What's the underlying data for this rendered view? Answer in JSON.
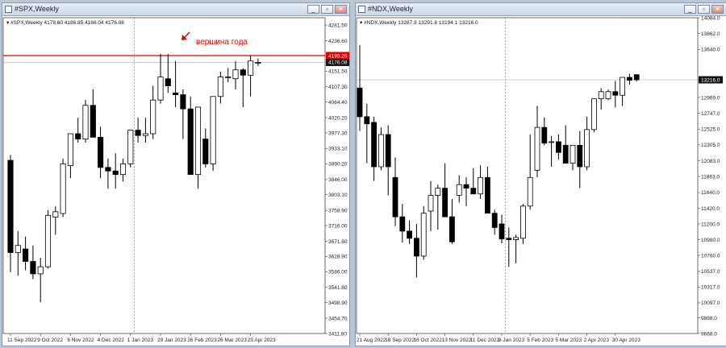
{
  "colors": {
    "bull_body": "#ffffff",
    "bear_body": "#000000",
    "candle_outline": "#000000",
    "level_line": "#e00000",
    "annotation": "#e00000",
    "current_price_label": "#111111",
    "grid": "#9a9a9a"
  },
  "windows": {
    "spx": {
      "title": "#SPX,Weekly",
      "buttons": [
        "minimize-icon",
        "restore-icon",
        "close-icon"
      ]
    },
    "ndx": {
      "title": "#NDX,Weekly",
      "buttons": [
        "minimize-icon",
        "restore-icon",
        "close-icon"
      ]
    }
  },
  "chart_data": [
    {
      "type": "candlestick",
      "symbol": "#SPX,Weekly",
      "ohlc_info": "4178.60 4186.85 4166.04 4176.08",
      "ylim": [
        3411.8,
        4302.0
      ],
      "y_ticks": [
        "4281.50",
        "4236.60",
        "4195.26",
        "4176.08",
        "4151.50",
        "4107.30",
        "4064.40",
        "4020.20",
        "3977.30",
        "3933.10",
        "3890.20",
        "3846.00",
        "3803.10",
        "3758.90",
        "3716.00",
        "3671.80",
        "3628.90",
        "3586.00",
        "3541.80",
        "3498.90",
        "3454.70",
        "3411.80"
      ],
      "x_ticks": [
        "11 Sep 2022",
        "9 Oct 2022",
        "6 Nov 2022",
        "4 Dec 2022",
        "1 Jan 2023",
        "29 Jan 2023",
        "26 Feb 2023",
        "26 Mar 2023",
        "23 Apr 2023"
      ],
      "x_tick_index": [
        0,
        4,
        8,
        12,
        16,
        20,
        24,
        28,
        32
      ],
      "period_separator_index": 16.5,
      "level_line": 4195.26,
      "level_label": "4195.26",
      "current_price": 4176.08,
      "current_label": "4176.08",
      "annotation": "вершина года",
      "candles": [
        [
          3900,
          3915,
          3585,
          3640
        ],
        [
          3640,
          3700,
          3575,
          3660
        ],
        [
          3650,
          3685,
          3590,
          3615
        ],
        [
          3615,
          3660,
          3565,
          3580
        ],
        [
          3580,
          3625,
          3500,
          3600
        ],
        [
          3600,
          3760,
          3595,
          3745
        ],
        [
          3740,
          3770,
          3690,
          3755
        ],
        [
          3750,
          3905,
          3740,
          3890
        ],
        [
          3885,
          3950,
          3850,
          3975
        ],
        [
          3975,
          4020,
          3950,
          3960
        ],
        [
          3960,
          4070,
          3950,
          4055
        ],
        [
          4055,
          4100,
          3980,
          3965
        ],
        [
          3965,
          3995,
          3850,
          3880
        ],
        [
          3880,
          3905,
          3820,
          3870
        ],
        [
          3870,
          3920,
          3820,
          3860
        ],
        [
          3860,
          3905,
          3840,
          3890
        ],
        [
          3890,
          3960,
          3880,
          3985
        ],
        [
          3985,
          4020,
          3950,
          3970
        ],
        [
          3970,
          4020,
          3950,
          3975
        ],
        [
          3975,
          4110,
          3960,
          4070
        ],
        [
          4070,
          4200,
          4060,
          4135
        ],
        [
          4130,
          4200,
          4090,
          4110
        ],
        [
          4090,
          4180,
          4050,
          4085
        ],
        [
          4085,
          4100,
          3960,
          4045
        ],
        [
          4045,
          4080,
          3890,
          3860
        ],
        [
          3860,
          4050,
          3820,
          4050
        ],
        [
          3960,
          3990,
          3880,
          3890
        ],
        [
          3890,
          4030,
          3870,
          4080
        ],
        [
          4080,
          4150,
          4060,
          4135
        ],
        [
          4135,
          4160,
          4120,
          4135
        ],
        [
          4130,
          4180,
          4100,
          4155
        ],
        [
          4155,
          4160,
          4050,
          4140
        ],
        [
          4140,
          4195,
          4080,
          4180
        ],
        [
          4176,
          4187,
          4166,
          4176
        ]
      ]
    },
    {
      "type": "candlestick",
      "symbol": "#NDX,Weekly",
      "ohlc_info": "13287.8 13291.8 13194.1 13216.0",
      "ylim": [
        9668.0,
        14084.0
      ],
      "y_ticks": [
        "14084.0",
        "13862.0",
        "13640.0",
        "13216.0",
        "12969.0",
        "12747.0",
        "12525.0",
        "12305.0",
        "12083.0",
        "11863.0",
        "11640.0",
        "11420.0",
        "11200.0",
        "10980.0",
        "10760.0",
        "10537.0",
        "10317.0",
        "10097.0",
        "9888.0",
        "9668.0"
      ],
      "x_ticks": [
        "21 Aug 2022",
        "18 Sep 2022",
        "16 Oct 2022",
        "13 Nov 2022",
        "11 Dec 2022",
        "8 Jan 2023",
        "5 Feb 2023",
        "5 Mar 2023",
        "2 Apr 2023",
        "30 Apr 2023"
      ],
      "x_tick_index": [
        0,
        4,
        8,
        12,
        16,
        20,
        24,
        28,
        32,
        36
      ],
      "period_separator_index": 20.5,
      "current_price": 13216.0,
      "current_label": "13216.0",
      "candles": [
        [
          13100,
          13700,
          12500,
          12700
        ],
        [
          12700,
          12880,
          12050,
          12600
        ],
        [
          12620,
          12700,
          11800,
          12000
        ],
        [
          12000,
          12550,
          11950,
          12450
        ],
        [
          12450,
          12580,
          11600,
          12000
        ],
        [
          11850,
          12130,
          11170,
          11300
        ],
        [
          11300,
          11480,
          10940,
          11100
        ],
        [
          11100,
          11250,
          10920,
          11000
        ],
        [
          11000,
          11200,
          10450,
          10750
        ],
        [
          10750,
          11450,
          10700,
          11350
        ],
        [
          11380,
          11800,
          11100,
          11600
        ],
        [
          11600,
          11750,
          11120,
          11700
        ],
        [
          11700,
          12050,
          11450,
          11300
        ],
        [
          11300,
          11550,
          10920,
          10950
        ],
        [
          11600,
          11880,
          11500,
          11750
        ],
        [
          11750,
          11850,
          11450,
          11700
        ],
        [
          11700,
          11980,
          11620,
          11620
        ],
        [
          11620,
          12020,
          11550,
          11850
        ],
        [
          11850,
          12000,
          11500,
          11350
        ],
        [
          11350,
          11400,
          11050,
          11150
        ],
        [
          11200,
          11330,
          10930,
          10990
        ],
        [
          11000,
          11150,
          10600,
          10980
        ],
        [
          10980,
          11050,
          10650,
          11010
        ],
        [
          11000,
          11480,
          10920,
          11450
        ],
        [
          11450,
          12450,
          11400,
          11850
        ],
        [
          11950,
          12850,
          11850,
          12550
        ],
        [
          12550,
          12690,
          12300,
          12330
        ],
        [
          12350,
          12430,
          12000,
          12350
        ],
        [
          12350,
          12450,
          12100,
          12200
        ],
        [
          12300,
          12580,
          12100,
          12050
        ],
        [
          12050,
          12300,
          11950,
          12300
        ],
        [
          12300,
          12500,
          11700,
          12000
        ],
        [
          12000,
          12700,
          11950,
          12520
        ],
        [
          12520,
          12900,
          12480,
          12950
        ],
        [
          12950,
          13100,
          12800,
          13050
        ],
        [
          12950,
          13080,
          12930,
          13050
        ],
        [
          13050,
          13200,
          12830,
          13000
        ],
        [
          13000,
          13200,
          12850,
          13250
        ],
        [
          13250,
          13300,
          13150,
          13210
        ],
        [
          13287.8,
          13291.8,
          13194.1,
          13216.0
        ]
      ]
    }
  ]
}
